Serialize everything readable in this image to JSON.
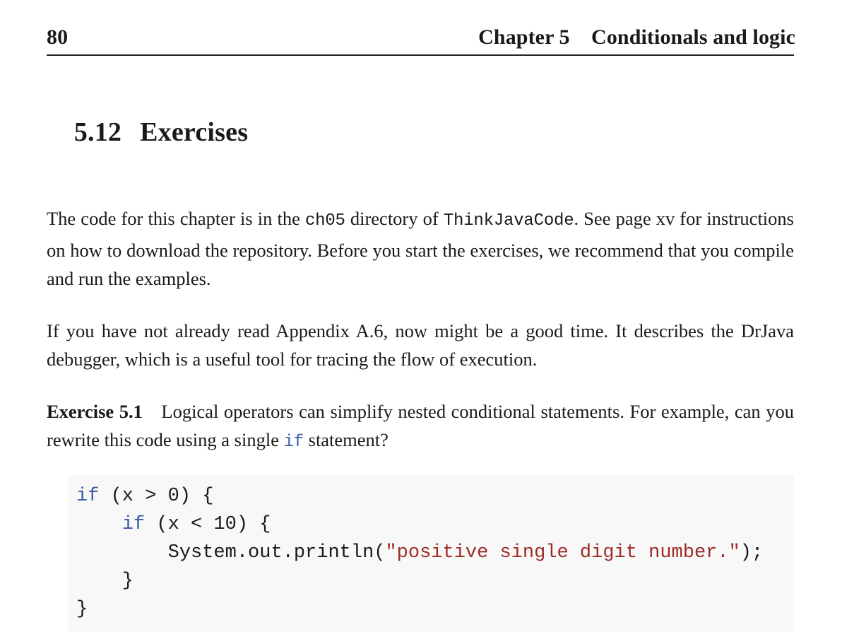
{
  "header": {
    "folio": "80",
    "running_title": "Chapter 5    Conditionals and logic"
  },
  "section": {
    "number": "5.12",
    "title": "Exercises"
  },
  "paragraphs": [
    {
      "id": "repo-paragraph",
      "runs": [
        {
          "text": "The code for this chapter is in the ",
          "style": "normal"
        },
        {
          "text": "ch05",
          "style": "mono"
        },
        {
          "text": " directory of ",
          "style": "normal"
        },
        {
          "text": "ThinkJavaCode",
          "style": "mono"
        },
        {
          "text": ". See page xv for instructions on how to download the repository. Before you start the exercises, we recommend that you compile and run the examples.",
          "style": "normal"
        }
      ]
    },
    {
      "id": "debugger-paragraph",
      "runs": [
        {
          "text": "If you have not already read Appendix A.6, now might be a good time. It describes the DrJava debugger, which is a useful tool for tracing the flow of execution.",
          "style": "normal"
        }
      ]
    },
    {
      "id": "exercise-paragraph",
      "runs": [
        {
          "text": "Exercise 5.1",
          "style": "bold"
        },
        {
          "text": " Logical operators can simplify nested conditional statements. For example, can you rewrite this code using a single ",
          "style": "normal"
        },
        {
          "text": "if",
          "style": "keyword-inline"
        },
        {
          "text": " statement?",
          "style": "normal"
        }
      ]
    }
  ],
  "code_block": {
    "language": "java",
    "background": "#f8f8f8",
    "keyword_color": "#3b5ca8",
    "string_color": "#9e2b25",
    "text_color": "#1a1a1a",
    "lines": [
      [
        {
          "text": "if",
          "tok": "kw"
        },
        {
          "text": " (x > 0) {",
          "tok": "pl"
        }
      ],
      [
        {
          "text": "    ",
          "tok": "pl"
        },
        {
          "text": "if",
          "tok": "kw"
        },
        {
          "text": " (x < 10) {",
          "tok": "pl"
        }
      ],
      [
        {
          "text": "        System.out.println(",
          "tok": "pl"
        },
        {
          "text": "\"positive single digit number.\"",
          "tok": "str"
        },
        {
          "text": ");",
          "tok": "pl"
        }
      ],
      [
        {
          "text": "    }",
          "tok": "pl"
        }
      ],
      [
        {
          "text": "}",
          "tok": "pl"
        }
      ]
    ]
  }
}
